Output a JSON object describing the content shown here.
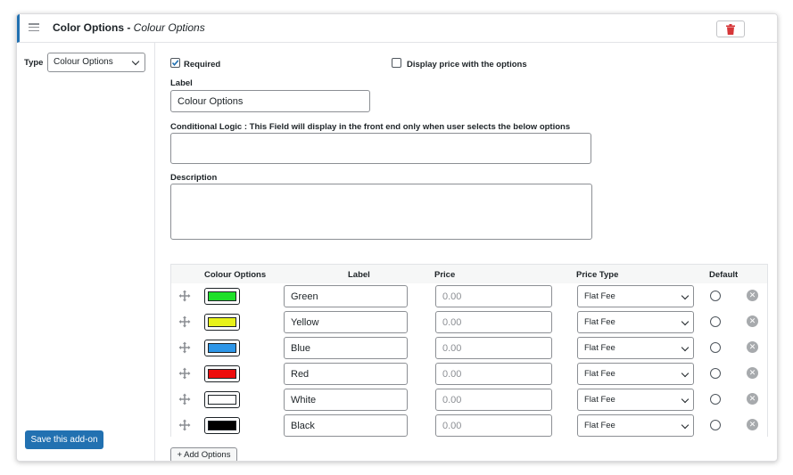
{
  "header": {
    "title": "Color Options -",
    "title_italic": "Colour Options"
  },
  "sidebar": {
    "type_label": "Type",
    "type_value": "Colour Options",
    "save_label": "Save this add-on"
  },
  "form": {
    "required_label": "Required",
    "required_checked": true,
    "display_price_label": "Display price with the options",
    "display_price_checked": false,
    "label_heading": "Label",
    "label_value": "Colour Options",
    "conditional_heading": "Conditional Logic : This Field will display in the front end only when user selects the below options",
    "conditional_value": "",
    "description_heading": "Description",
    "description_value": ""
  },
  "options_table": {
    "headers": {
      "colour": "Colour Options",
      "label": "Label",
      "price": "Price",
      "price_type": "Price Type",
      "default": "Default"
    },
    "rows": [
      {
        "label": "Green",
        "color": "#1ee02a",
        "price_placeholder": "0.00",
        "price_type": "Flat Fee"
      },
      {
        "label": "Yellow",
        "color": "#e8f21a",
        "price_placeholder": "0.00",
        "price_type": "Flat Fee"
      },
      {
        "label": "Blue",
        "color": "#2d96e8",
        "price_placeholder": "0.00",
        "price_type": "Flat Fee"
      },
      {
        "label": "Red",
        "color": "#ee0c0c",
        "price_placeholder": "0.00",
        "price_type": "Flat Fee"
      },
      {
        "label": "White",
        "color": "#ffffff",
        "price_placeholder": "0.00",
        "price_type": "Flat Fee"
      },
      {
        "label": "Black",
        "color": "#000000",
        "price_placeholder": "0.00",
        "price_type": "Flat Fee"
      }
    ]
  },
  "add_options_label": "+ Add Options",
  "colors": {
    "accent": "#2271b1",
    "delete": "#d63638"
  }
}
